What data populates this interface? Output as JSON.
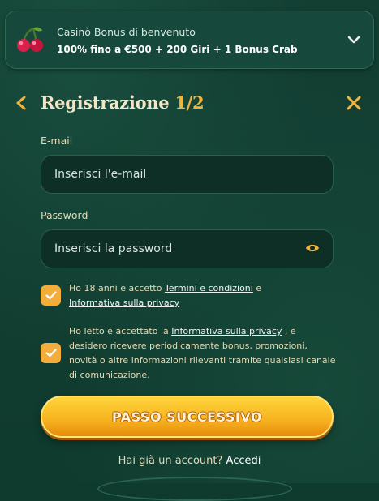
{
  "bonus": {
    "title": "Casinò Bonus di benvenuto",
    "subtitle": "100% fino a €500 + 200 Giri + 1 Bonus Crab"
  },
  "header": {
    "title": "Registrazione ",
    "step": "1/2"
  },
  "email": {
    "label": "E-mail",
    "placeholder": "Inserisci l'e-mail"
  },
  "password": {
    "label": "Password",
    "placeholder": "Inserisci la password"
  },
  "consent1": {
    "prefix": "Ho 18 anni e accetto ",
    "link1": "Termini e condizioni",
    "middle": " e",
    "link2": "Informativa sulla privacy"
  },
  "consent2": {
    "prefix": "Ho letto e accettato la ",
    "link": "Informativa sulla privacy",
    "suffix": " , e desidero ricevere periodicamente bonus, promozioni, novità o altre informazioni rilevanti tramite qualsiasi canale di comunicazione."
  },
  "cta": {
    "label": "PASSO SUCCESSIVO"
  },
  "footer": {
    "text": "Hai già un account? ",
    "link": "Accedi"
  },
  "colors": {
    "accent": "#f1b43d",
    "checkbox": "#f2ad3b",
    "background": "#0f3b2f"
  },
  "icons": [
    "cherry-icon",
    "chevron-down-icon",
    "chevron-left-icon",
    "close-icon",
    "eye-icon",
    "checkmark-icon"
  ]
}
